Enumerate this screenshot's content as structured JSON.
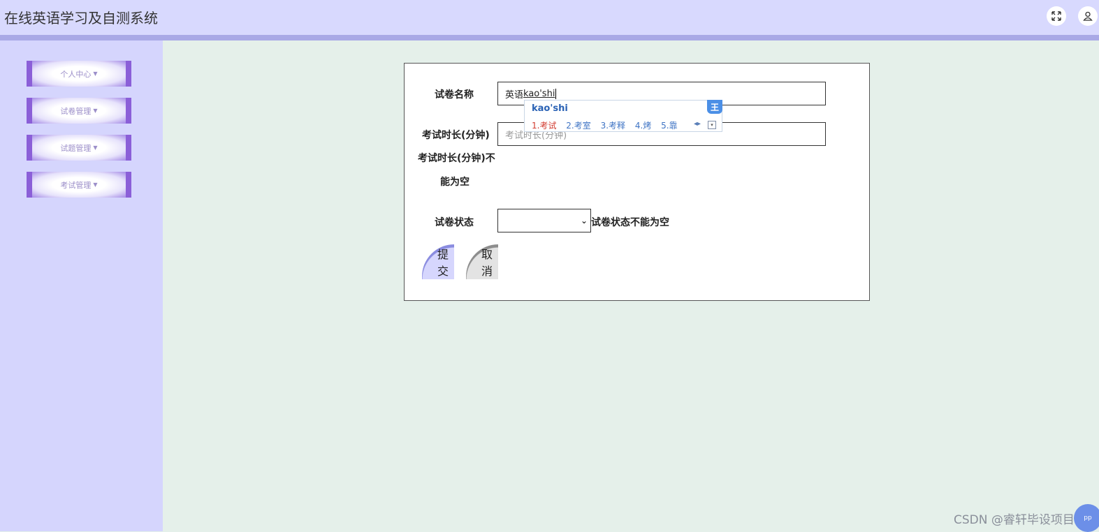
{
  "app": {
    "title": "在线英语学习及自测系统"
  },
  "header_icons": {
    "fullscreen": "expand-icon",
    "user": "user-icon"
  },
  "sidebar": {
    "items": [
      {
        "label": "个人中心"
      },
      {
        "label": "试卷管理"
      },
      {
        "label": "试题管理"
      },
      {
        "label": "考试管理"
      }
    ]
  },
  "form": {
    "name_label": "试卷名称",
    "name_value_prefix": "英语",
    "name_value_pinyin": "kao'shi",
    "duration_label": "考试时长(分钟)",
    "duration_placeholder": "考试时长(分钟)",
    "duration_error_line1": "考试时长(分钟)不",
    "duration_error_line2": "能为空",
    "status_label": "试卷状态",
    "status_value": "",
    "status_error": "试卷状态不能为空",
    "submit_label": "提交",
    "cancel_label": "取消"
  },
  "ime": {
    "pinyin": "kao'shi",
    "badge": "王",
    "candidates": [
      "1.考试",
      "2.考室",
      "3.考释",
      "4.烤",
      "5.靠"
    ]
  },
  "watermark": "CSDN @睿轩毕设项目",
  "colors": {
    "header_bg": "#d8d9fe",
    "sidebar_bg": "#d5d5fd",
    "content_bg": "#e5f0ea",
    "menu_accent": "#8b5fd8"
  }
}
